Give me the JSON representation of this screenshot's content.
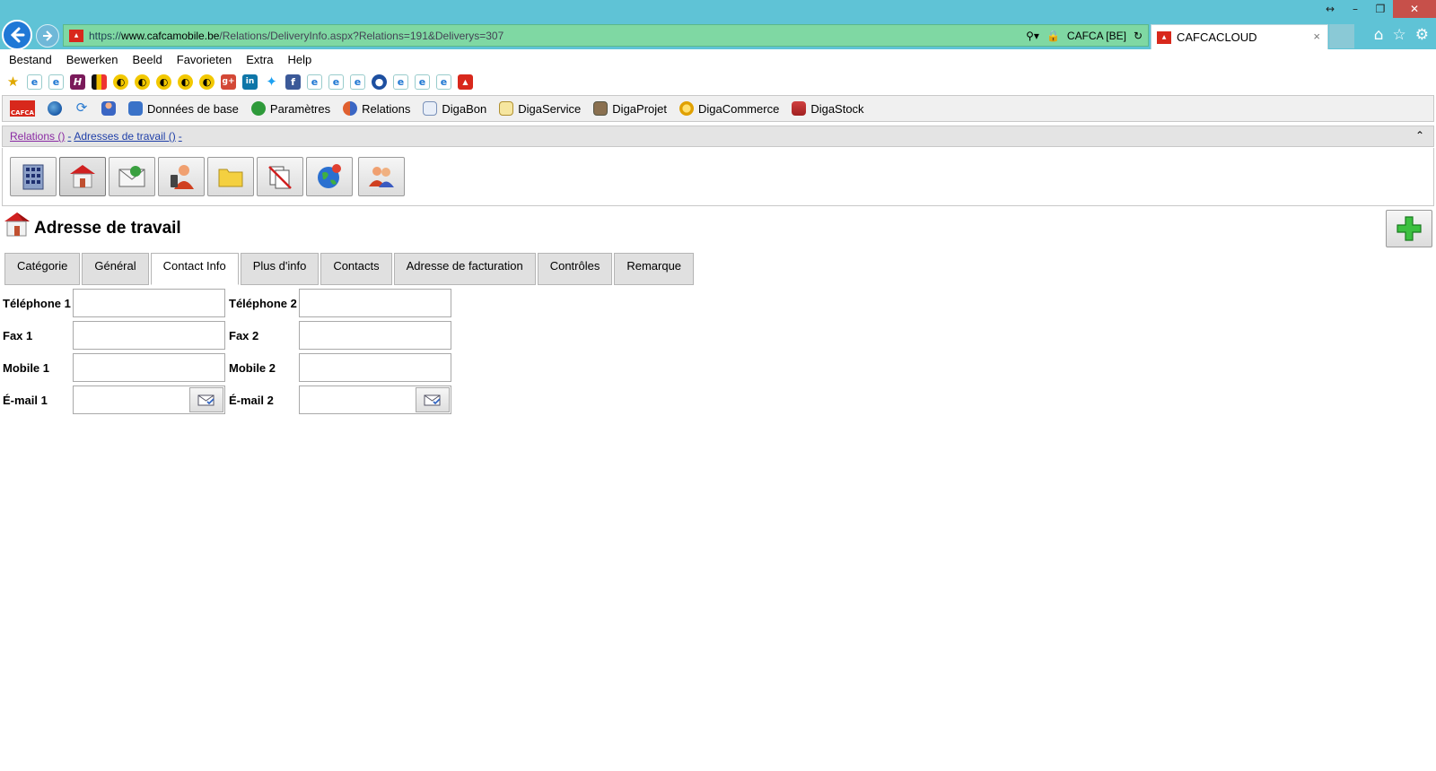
{
  "browser": {
    "url_scheme": "https://",
    "url_host": "www.cafcamobile.be",
    "url_path": "/Relations/DeliveryInfo.aspx?Relations=191&Deliverys=307",
    "site_identity": "CAFCA [BE]",
    "tab_title": "CAFCACLOUD",
    "tab_close": "×"
  },
  "menu": {
    "items": [
      "Bestand",
      "Bewerken",
      "Beeld",
      "Favorieten",
      "Extra",
      "Help"
    ]
  },
  "favorites": {
    "h_icon_label": "H",
    "gplus_label": "g+",
    "linkedin_label": "in",
    "facebook_label": "f"
  },
  "app_toolbar": {
    "logo_text": "CAFCA",
    "items": [
      "Données de base",
      "Paramètres",
      "Relations",
      "DigaBon",
      "DigaService",
      "DigaProjet",
      "DigaCommerce",
      "DigaStock"
    ]
  },
  "breadcrumb": {
    "relations": "Relations ()",
    "separator": "-",
    "work_addresses": "Adresses de travail ()",
    "trailing": "-"
  },
  "page": {
    "title": "Adresse de travail"
  },
  "tabs": [
    "Catégorie",
    "Général",
    "Contact Info",
    "Plus d'info",
    "Contacts",
    "Adresse de facturation",
    "Contrôles",
    "Remarque"
  ],
  "selected_tab": "Contact Info",
  "form": {
    "phone1_label": "Téléphone 1",
    "phone2_label": "Téléphone 2",
    "fax1_label": "Fax 1",
    "fax2_label": "Fax 2",
    "mobile1_label": "Mobile 1",
    "mobile2_label": "Mobile 2",
    "email1_label": "É-mail 1",
    "email2_label": "É-mail 2",
    "phone1_value": "",
    "phone2_value": "",
    "fax1_value": "",
    "fax2_value": "",
    "mobile1_value": "",
    "mobile2_value": "",
    "email1_value": "",
    "email2_value": ""
  },
  "colors": {
    "titlebar": "#5fc3d6",
    "addressbar": "#7fd8a3",
    "link": "#1f3fa8",
    "visited_link": "#8a2aa3",
    "cafca_red": "#d8281c"
  }
}
